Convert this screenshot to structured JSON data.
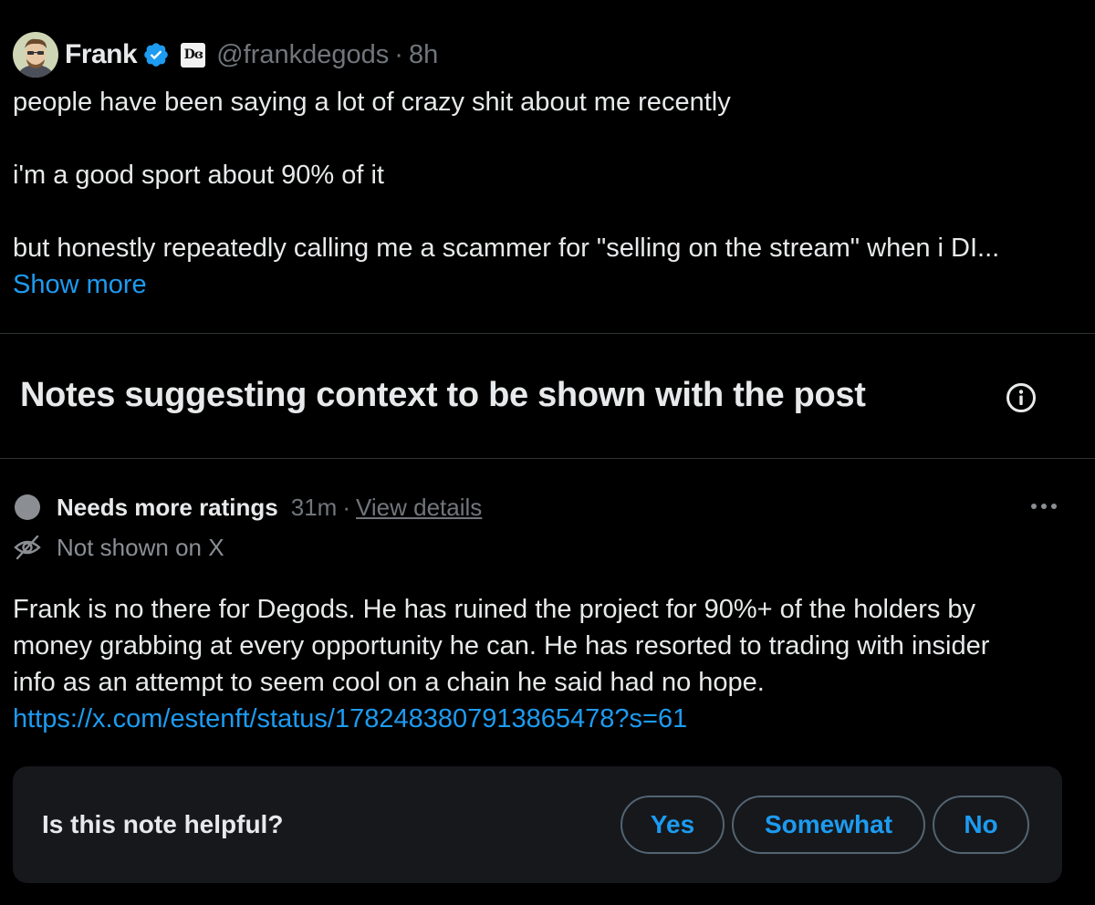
{
  "post": {
    "author_name": "Frank",
    "affiliate_badge_text": "Dɞ",
    "handle": "@frankdegods",
    "separator": "·",
    "time": "8h",
    "lines": [
      "people have been saying a lot of crazy shit about me recently",
      "i'm a good sport about 90% of it",
      "but honestly repeatedly calling me a scammer for \"selling on the stream\" when i DI..."
    ],
    "show_more_label": "Show more"
  },
  "notes_section": {
    "heading": "Notes suggesting context to be shown with the post",
    "info_icon": "info-circle-icon"
  },
  "note": {
    "status": "Needs more ratings",
    "age": "31m",
    "separator": "·",
    "view_details_label": "View details",
    "visibility": "Not shown on X",
    "body_lines": [
      "Frank is no there for Degods. He has ruined the project for 90%+ of the holders by",
      "money grabbing at every opportunity he can. He has resorted to trading with insider",
      "info as an attempt to seem cool on a chain he said had no hope."
    ],
    "link": "https://x.com/estenft/status/1782483807913865478?s=61"
  },
  "rating": {
    "question": "Is this note helpful?",
    "yes_label": "Yes",
    "somewhat_label": "Somewhat",
    "no_label": "No"
  },
  "colors": {
    "background": "#000000",
    "text": "#e7e9ea",
    "muted": "#71767b",
    "accent": "#1d9bf0",
    "card": "#16181c",
    "divider": "#2f3336"
  }
}
